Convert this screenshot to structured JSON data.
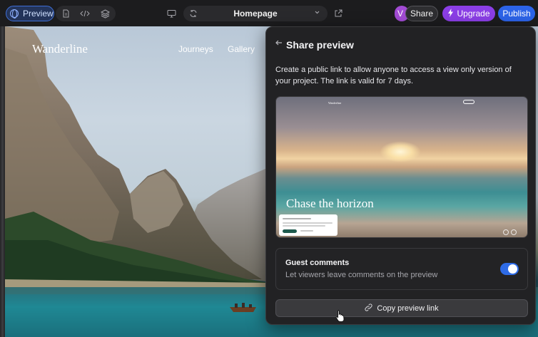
{
  "toolbar": {
    "preview_label": "Preview",
    "page_name": "Homepage",
    "avatar_initial": "V",
    "share_label": "Share",
    "upgrade_label": "Upgrade",
    "publish_label": "Publish",
    "icons": [
      "globe-icon",
      "file-icon",
      "code-icon",
      "layers-icon",
      "desktop-icon",
      "sync-icon",
      "chevron-down-icon",
      "external-link-icon",
      "bolt-icon"
    ]
  },
  "site": {
    "logo": "Wanderline",
    "nav": [
      "Journeys",
      "Gallery"
    ]
  },
  "share_panel": {
    "title": "Share preview",
    "description": "Create a public link to allow anyone to access a view only version of your project. The link is valid for 7 days.",
    "thumbnail": {
      "headline": "Chase the horizon",
      "logo": "Wanderline"
    },
    "guest_comments": {
      "title": "Guest comments",
      "subtitle": "Let viewers leave comments on the preview",
      "enabled": true
    },
    "copy_label": "Copy preview link"
  },
  "colors": {
    "accent_blue": "#2c63e8",
    "upgrade_purple": "#8b3ee6",
    "panel_bg": "#222224"
  }
}
